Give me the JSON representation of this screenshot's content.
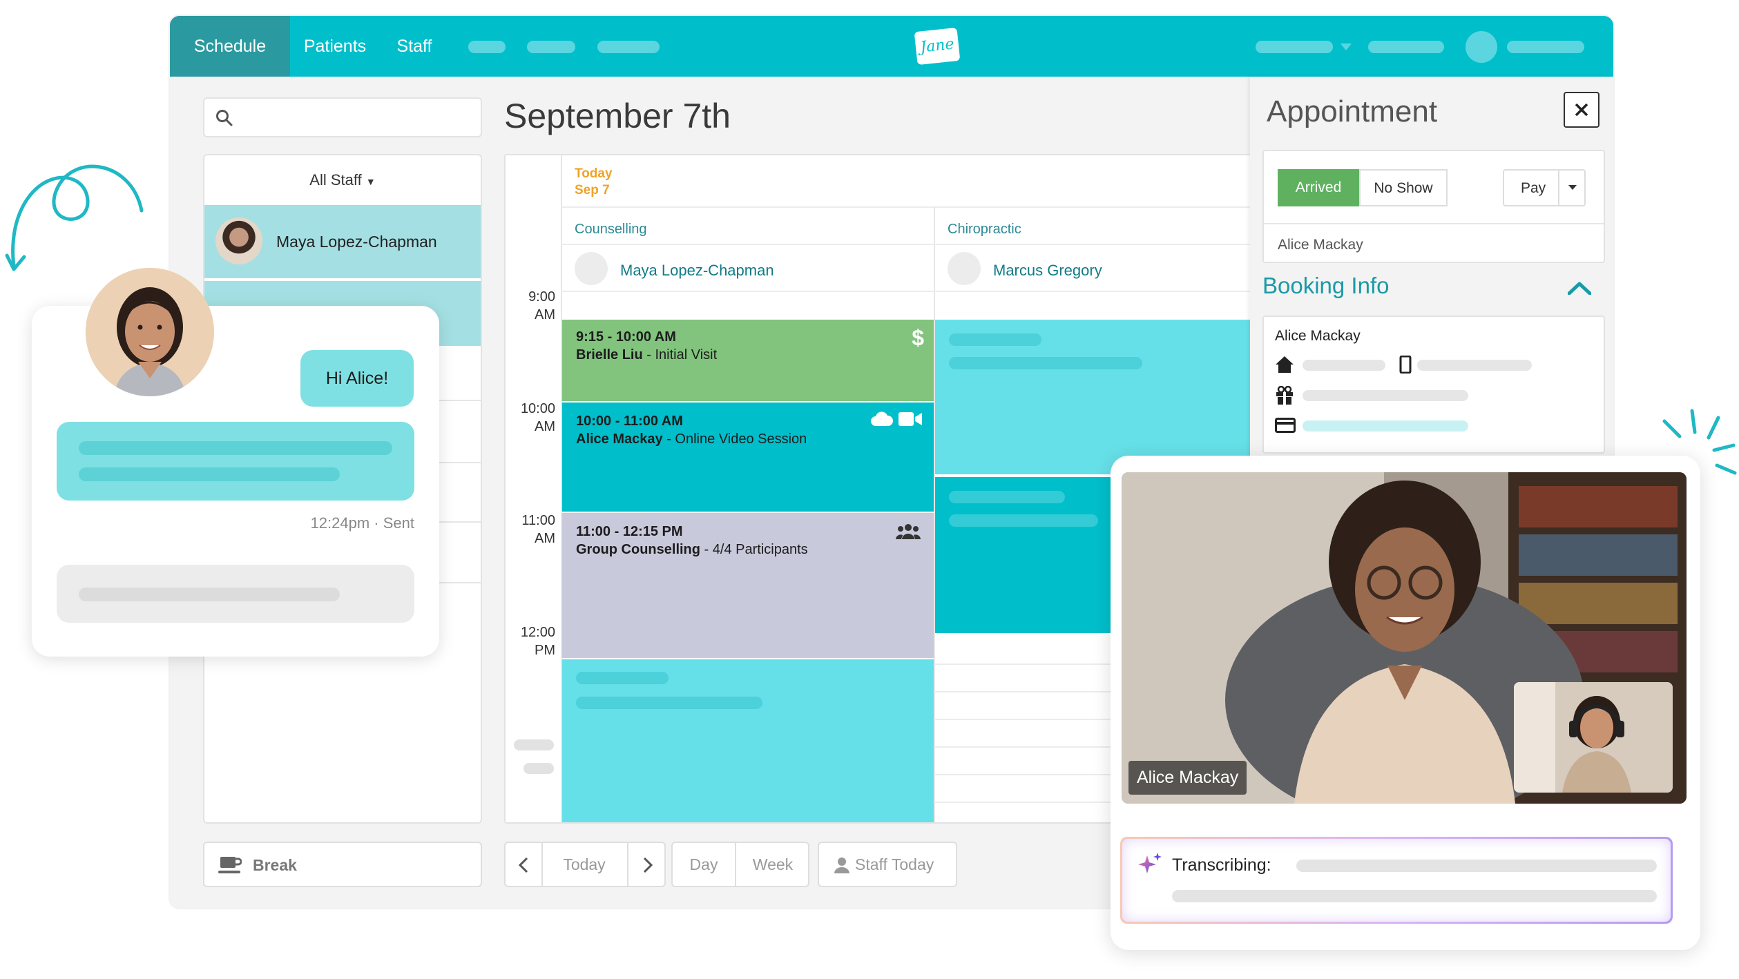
{
  "nav": {
    "tabs": [
      {
        "label": "Schedule"
      },
      {
        "label": "Patients"
      },
      {
        "label": "Staff"
      }
    ],
    "logo_text": "Jane"
  },
  "search": {
    "placeholder": ""
  },
  "staff_filter": {
    "label": "All Staff",
    "selected_staff": "Maya Lopez-Chapman"
  },
  "calendar": {
    "date_title": "September 7th",
    "today_label": "Today",
    "today_date": "Sep 7",
    "columns": [
      {
        "discipline": "Counselling",
        "practitioner": "Maya Lopez-Chapman"
      },
      {
        "discipline": "Chiropractic",
        "practitioner": "Marcus Gregory"
      }
    ],
    "hours": [
      {
        "h": "9:00",
        "p": "AM"
      },
      {
        "h": "10:00",
        "p": "AM"
      },
      {
        "h": "11:00",
        "p": "AM"
      },
      {
        "h": "12:00",
        "p": "PM"
      }
    ],
    "appointments": [
      {
        "time": "9:15 - 10:00 AM",
        "name": "Brielle Liu",
        "detail": " - Initial Visit",
        "icon": "dollar-icon"
      },
      {
        "time": "10:00 - 11:00 AM",
        "name": "Alice Mackay",
        "detail": " - Online Video Session",
        "icon": "cloud-video-icon"
      },
      {
        "time": "11:00 - 12:15 PM",
        "name": "Group Counselling",
        "detail": " - 4/4 Participants",
        "icon": "group-icon"
      }
    ],
    "colors": {
      "green": "#82c47e",
      "teal": "#00bfcb",
      "lavender": "#c9c9dc",
      "light_teal": "#66e0e8"
    }
  },
  "footer": {
    "break_label": "Break",
    "today_btn": "Today",
    "day_btn": "Day",
    "week_btn": "Week",
    "staff_today_btn": "Staff Today"
  },
  "appointment_panel": {
    "title": "Appointment",
    "arrived": "Arrived",
    "no_show": "No Show",
    "pay": "Pay",
    "patient": "Alice Mackay",
    "booking_info_title": "Booking Info",
    "booking_patient": "Alice Mackay"
  },
  "chat": {
    "message": "Hi Alice!",
    "timestamp": "12:24pm · Sent"
  },
  "video": {
    "caller_name": "Alice Mackay",
    "transcribing_label": "Transcribing:"
  }
}
